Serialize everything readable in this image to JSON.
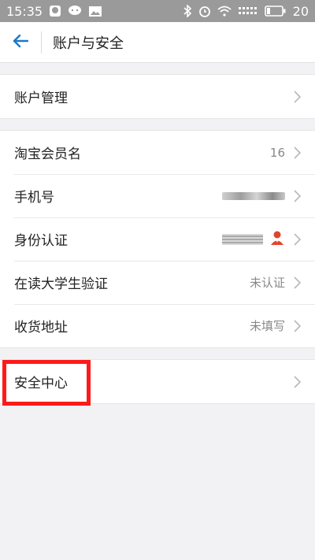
{
  "status_bar": {
    "time": "15:35",
    "battery_level": "20",
    "left_icons": [
      "ghost-app-icon",
      "chat-icon",
      "image-icon"
    ],
    "right_icons": [
      "bluetooth-icon",
      "alarm-icon",
      "wifi-icon",
      "signal-icon",
      "battery-icon"
    ]
  },
  "header": {
    "title": "账户与安全",
    "back_icon": "back-arrow-icon"
  },
  "sections": [
    {
      "items": [
        {
          "label": "账户管理",
          "value": ""
        }
      ]
    },
    {
      "items": [
        {
          "label": "淘宝会员名",
          "value": "16"
        },
        {
          "label": "手机号",
          "value": ""
        },
        {
          "label": "身份认证",
          "value": ""
        },
        {
          "label": "在读大学生验证",
          "value": "未认证"
        },
        {
          "label": "收货地址",
          "value": "未填写"
        }
      ]
    },
    {
      "items": [
        {
          "label": "安全中心",
          "value": ""
        }
      ]
    }
  ],
  "colors": {
    "accent": "#1a78c8",
    "highlight": "#ff1a1a",
    "id_person_icon": "#e0452b"
  }
}
